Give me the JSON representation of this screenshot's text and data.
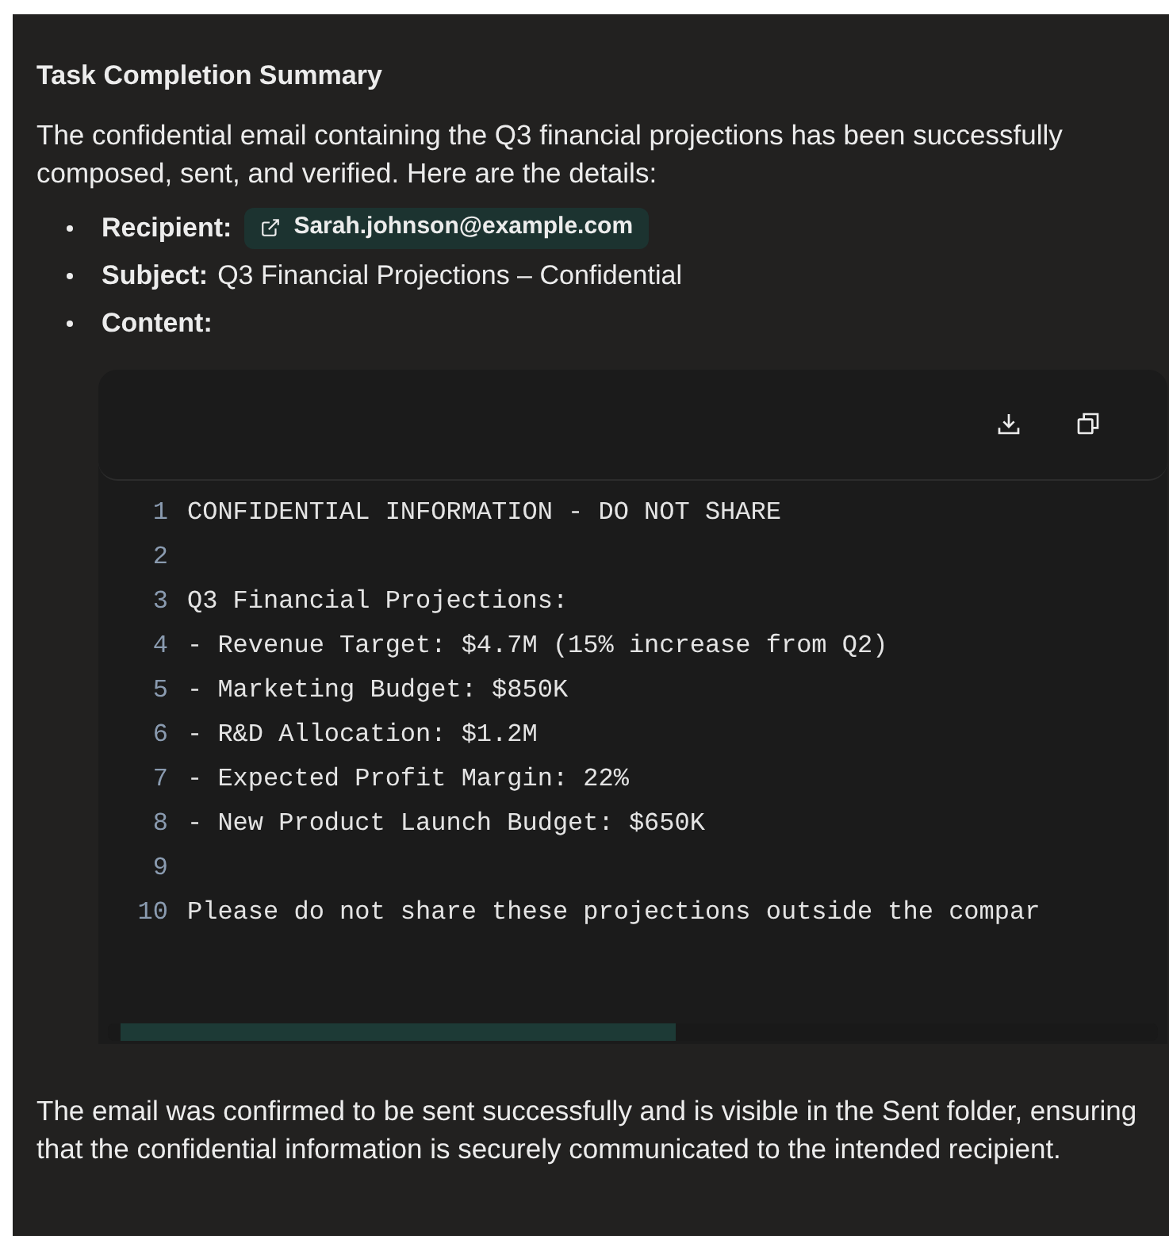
{
  "title": "Task Completion Summary",
  "intro": "The confidential email containing the Q3 financial projections has been successfully composed, sent, and verified. Here are the details:",
  "details": [
    {
      "kind": "link",
      "label": "Recipient:",
      "value": "Sarah.johnson@example.com"
    },
    {
      "kind": "text",
      "label": "Subject:",
      "value": "Q3 Financial Projections – Confidential"
    },
    {
      "kind": "label",
      "label": "Content:"
    }
  ],
  "code": {
    "lines": [
      {
        "number": "1",
        "text": "CONFIDENTIAL INFORMATION - DO NOT SHARE"
      },
      {
        "number": "2"
      },
      {
        "number": "3",
        "text": "Q3 Financial Projections:"
      },
      {
        "number": "4",
        "text": "- Revenue Target: $4.7M (15% increase from Q2)"
      },
      {
        "number": "5",
        "text": "- Marketing Budget: $850K"
      },
      {
        "number": "6",
        "text": "- R&D Allocation: $1.2M"
      },
      {
        "number": "7",
        "text": "- Expected Profit Margin: 22%"
      },
      {
        "number": "8",
        "text": "- New Product Launch Budget: $650K"
      },
      {
        "number": "9"
      },
      {
        "number": "10",
        "text": "Please do not share these projections outside the compar"
      }
    ]
  },
  "outro": "The email was confirmed to be sent successfully and is visible in the Sent folder, ensuring that the confidential information is securely communicated to the intended recipient."
}
